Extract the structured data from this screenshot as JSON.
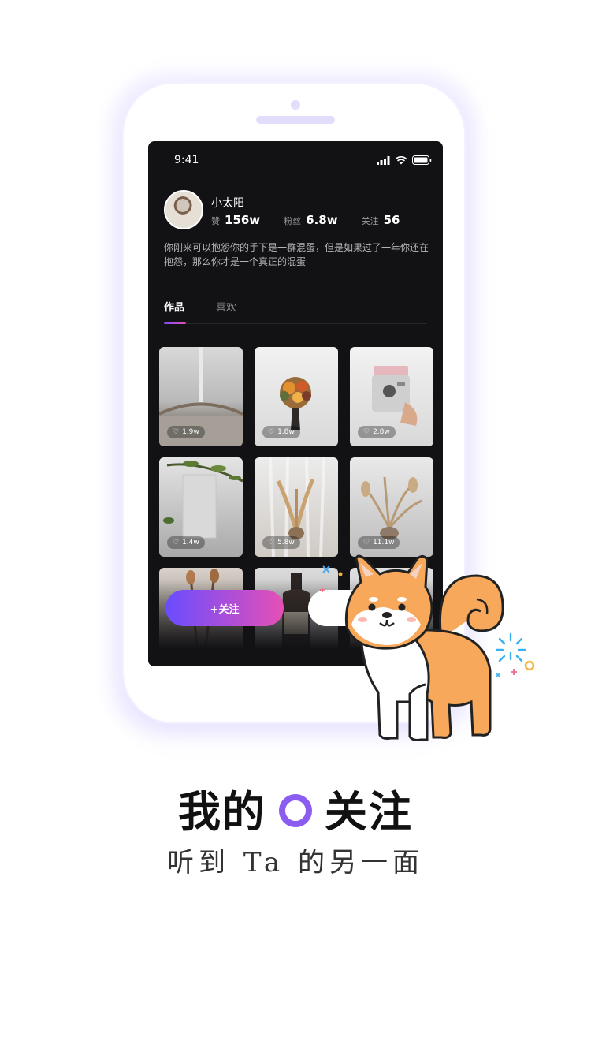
{
  "status": {
    "time": "9:41"
  },
  "profile": {
    "name": "小太阳",
    "stats": [
      {
        "label": "赞",
        "value": "156w"
      },
      {
        "label": "粉丝",
        "value": "6.8w"
      },
      {
        "label": "关注",
        "value": "56"
      }
    ],
    "bio": "你刚来可以抱怨你的手下是一群混蛋，但是如果过了一年你还在抱怨，那么你才是一个真正的混蛋"
  },
  "tabs": [
    {
      "label": "作品",
      "active": true
    },
    {
      "label": "喜欢",
      "active": false
    }
  ],
  "works": [
    {
      "likes": "1.9w",
      "subject": "interior"
    },
    {
      "likes": "1.8w",
      "subject": "flowers"
    },
    {
      "likes": "2.8w",
      "subject": "camera"
    },
    {
      "likes": "1.4w",
      "subject": "plant"
    },
    {
      "likes": "5.8w",
      "subject": "pampas"
    },
    {
      "likes": "11.1w",
      "subject": "dried"
    },
    {
      "likes": "",
      "subject": "dried-dark"
    },
    {
      "likes": "",
      "subject": "bottle"
    },
    {
      "likes": "",
      "subject": "grey"
    }
  ],
  "actions": {
    "follow_label": "+关注"
  },
  "headline": {
    "left": "我的",
    "right": "关注"
  },
  "tagline": "听到 Ta 的另一面",
  "colors": {
    "accent_start": "#6a4dff",
    "accent_end": "#e64fb6",
    "ring": "#8a5cf0",
    "dog_orange": "#f7a85a"
  }
}
